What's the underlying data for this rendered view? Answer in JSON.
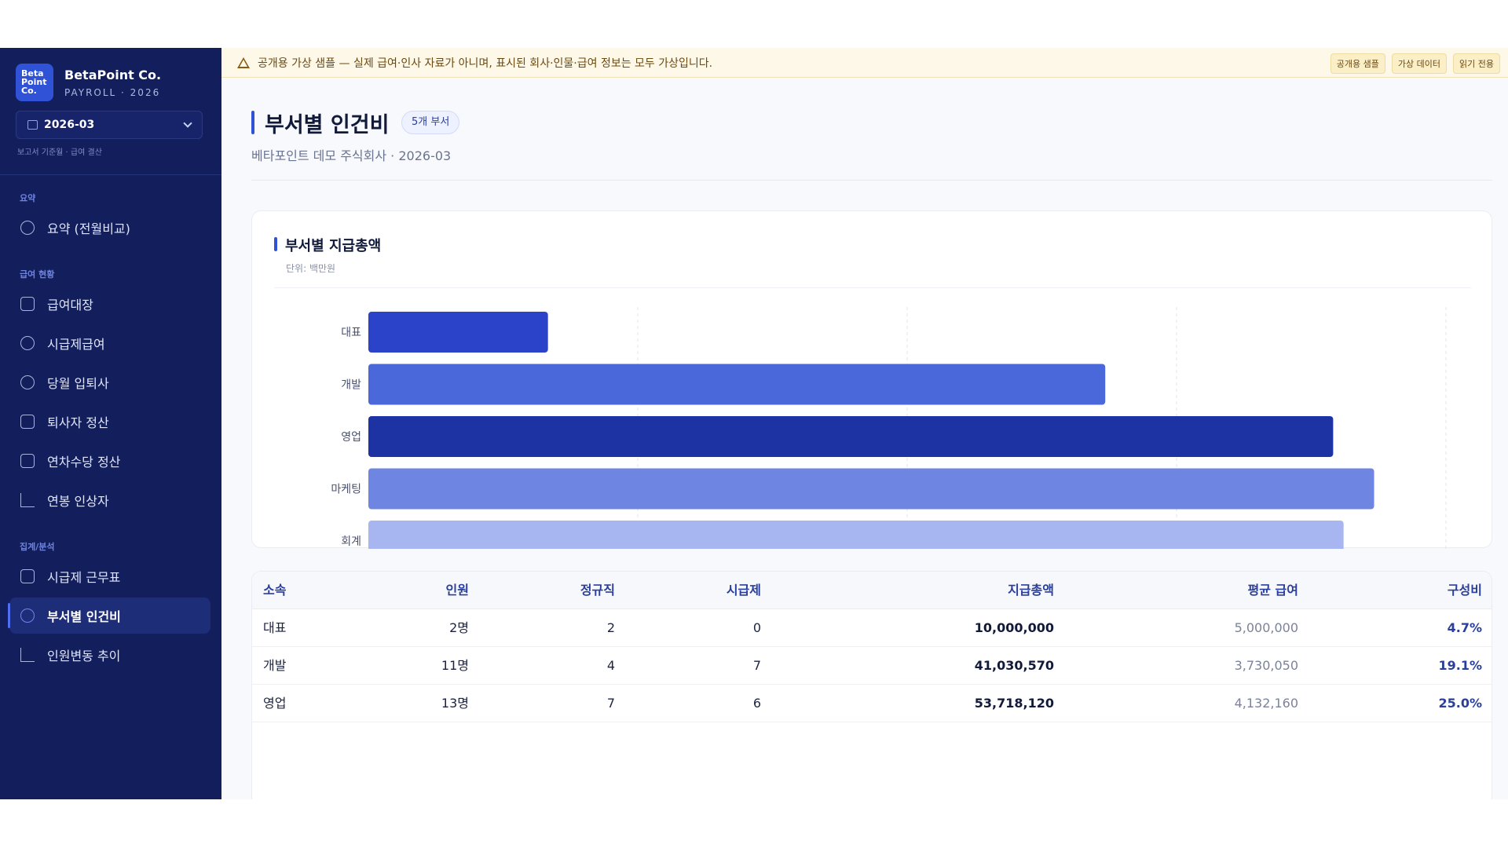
{
  "brand": {
    "logo_text": "Beta Point Co.",
    "name": "BetaPoint Co.",
    "sub": "PAYROLL · 2026"
  },
  "period": {
    "value": "2026-03",
    "hint": "보고서 기준월 · 급여 결산"
  },
  "sidebar": {
    "sections": [
      {
        "label": "요약",
        "items": [
          {
            "label": "요약 (전월비교)",
            "icon": "pie-chart-icon"
          }
        ]
      },
      {
        "label": "급여 현황",
        "items": [
          {
            "label": "급여대장",
            "icon": "document-icon"
          },
          {
            "label": "시급제급여",
            "icon": "clock-icon"
          },
          {
            "label": "당월 입퇴사",
            "icon": "user-plus-icon"
          },
          {
            "label": "퇴사자 정산",
            "icon": "calculator-icon"
          },
          {
            "label": "연차수당 정산",
            "icon": "calendar-icon"
          },
          {
            "label": "연봉 인상자",
            "icon": "trend-up-icon"
          }
        ]
      },
      {
        "label": "집계/분석",
        "items": [
          {
            "label": "시급제 근무표",
            "icon": "calendar-clock-icon"
          },
          {
            "label": "부서별 인건비",
            "icon": "users-icon",
            "active": true
          },
          {
            "label": "인원변동 추이",
            "icon": "line-chart-icon"
          }
        ]
      }
    ]
  },
  "notice": {
    "text": "공개용 가상 샘플 — 실제 급여·인사 자료가 아니며, 표시된 회사·인물·급여 정보는 모두 가상입니다.",
    "tags": [
      "공개용 샘플",
      "가상 데이터",
      "읽기 전용"
    ]
  },
  "page": {
    "title": "부서별 인건비",
    "badge": "5개 부서",
    "subtitle": "베타포인트 데모 주식회사 · 2026-03"
  },
  "chart_data": {
    "type": "bar",
    "orientation": "horizontal",
    "title": "부서별 지급총액",
    "unit": "단위: 백만원",
    "categories": [
      "대표",
      "개발",
      "영업",
      "마케팅",
      "회계"
    ],
    "values": [
      10.0,
      41.03,
      53.72,
      56.0,
      54.3
    ],
    "colors": [
      "#2a43c9",
      "#4b68db",
      "#1e33a3",
      "#6f85e2",
      "#a7b6f0"
    ],
    "xlim": [
      0,
      60
    ],
    "xticks": [
      0,
      15,
      30,
      45,
      60
    ],
    "grid": true
  },
  "table": {
    "headers": [
      "소속",
      "인원",
      "정규직",
      "시급제",
      "지급총액",
      "평균 급여",
      "구성비"
    ],
    "rows": [
      [
        "대표",
        "2명",
        "2",
        "0",
        "10,000,000",
        "5,000,000",
        "4.7%"
      ],
      [
        "개발",
        "11명",
        "4",
        "7",
        "41,030,570",
        "3,730,050",
        "19.1%"
      ],
      [
        "영업",
        "13명",
        "7",
        "6",
        "53,718,120",
        "4,132,160",
        "25.0%"
      ]
    ]
  }
}
